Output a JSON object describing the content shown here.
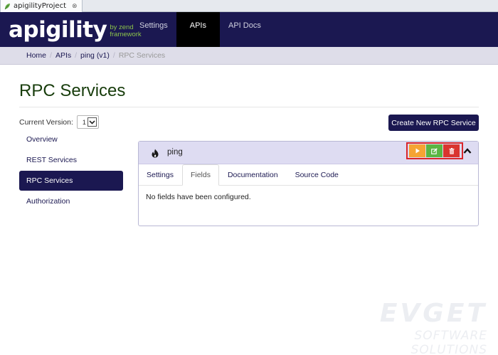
{
  "window": {
    "tab_title": "apigilityProject",
    "close_glyph": "⊗"
  },
  "brand": {
    "name": "apigility",
    "tagline_line1": "by zend",
    "tagline_line2": "framework"
  },
  "nav": {
    "items": [
      {
        "label": "Settings"
      },
      {
        "label": "APIs"
      },
      {
        "label": "API Docs"
      }
    ],
    "active": "APIs"
  },
  "breadcrumb": {
    "items": [
      "Home",
      "APIs",
      "ping (v1)",
      "RPC Services"
    ]
  },
  "page": {
    "title": "RPC Services"
  },
  "version": {
    "label": "Current Version:",
    "value": "1"
  },
  "create_button": {
    "label": "Create New RPC Service"
  },
  "sidebar": {
    "items": [
      {
        "label": "Overview"
      },
      {
        "label": "REST Services"
      },
      {
        "label": "RPC Services"
      },
      {
        "label": "Authorization"
      }
    ],
    "active": "RPC Services"
  },
  "service": {
    "name": "ping",
    "icon": "flame-icon",
    "tabs": [
      {
        "label": "Settings"
      },
      {
        "label": "Fields"
      },
      {
        "label": "Documentation"
      },
      {
        "label": "Source Code"
      }
    ],
    "active_tab": "Fields",
    "message": "No fields have been configured."
  },
  "colors": {
    "navbar": "#1b1851",
    "title": "#173c0b",
    "play": "#f5a433",
    "edit": "#5ab543",
    "delete": "#d9352f",
    "highlight": "#d9262b"
  },
  "watermark": {
    "main": "EVGET",
    "sub": "SOFTWARE SOLUTIONS"
  }
}
